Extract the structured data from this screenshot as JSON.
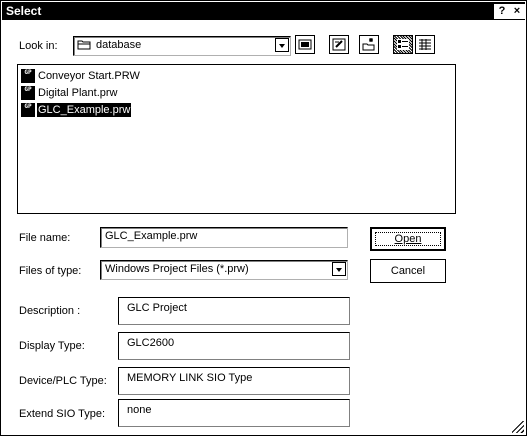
{
  "window": {
    "title": "Select",
    "help_label": "?",
    "close_label": "×"
  },
  "look_in": {
    "label": "Look in:",
    "value": "database"
  },
  "toolbar": {
    "icons": [
      "up-one-level-icon",
      "desktop-icon",
      "new-folder-icon",
      "list-view-icon",
      "details-view-icon"
    ]
  },
  "files": [
    {
      "name": "Conveyor Start.PRW",
      "icon_text": "GP",
      "selected": false
    },
    {
      "name": "Digital Plant.prw",
      "icon_text": "GP",
      "selected": false
    },
    {
      "name": "GLC_Example.prw",
      "icon_text": "GP",
      "selected": true
    }
  ],
  "file_name": {
    "label": "File name:",
    "value": "GLC_Example.prw"
  },
  "file_type": {
    "label": "Files of type:",
    "value": "Windows Project Files (*.prw)"
  },
  "buttons": {
    "open": "Open",
    "cancel": "Cancel"
  },
  "info": {
    "description_label": "Description :",
    "description_value": "GLC Project",
    "display_type_label": "Display Type:",
    "display_type_value": "GLC2600",
    "device_label": "Device/PLC Type:",
    "device_value": "MEMORY LINK SIO Type",
    "extend_sio_label": "Extend SIO Type:",
    "extend_sio_value": "none"
  }
}
